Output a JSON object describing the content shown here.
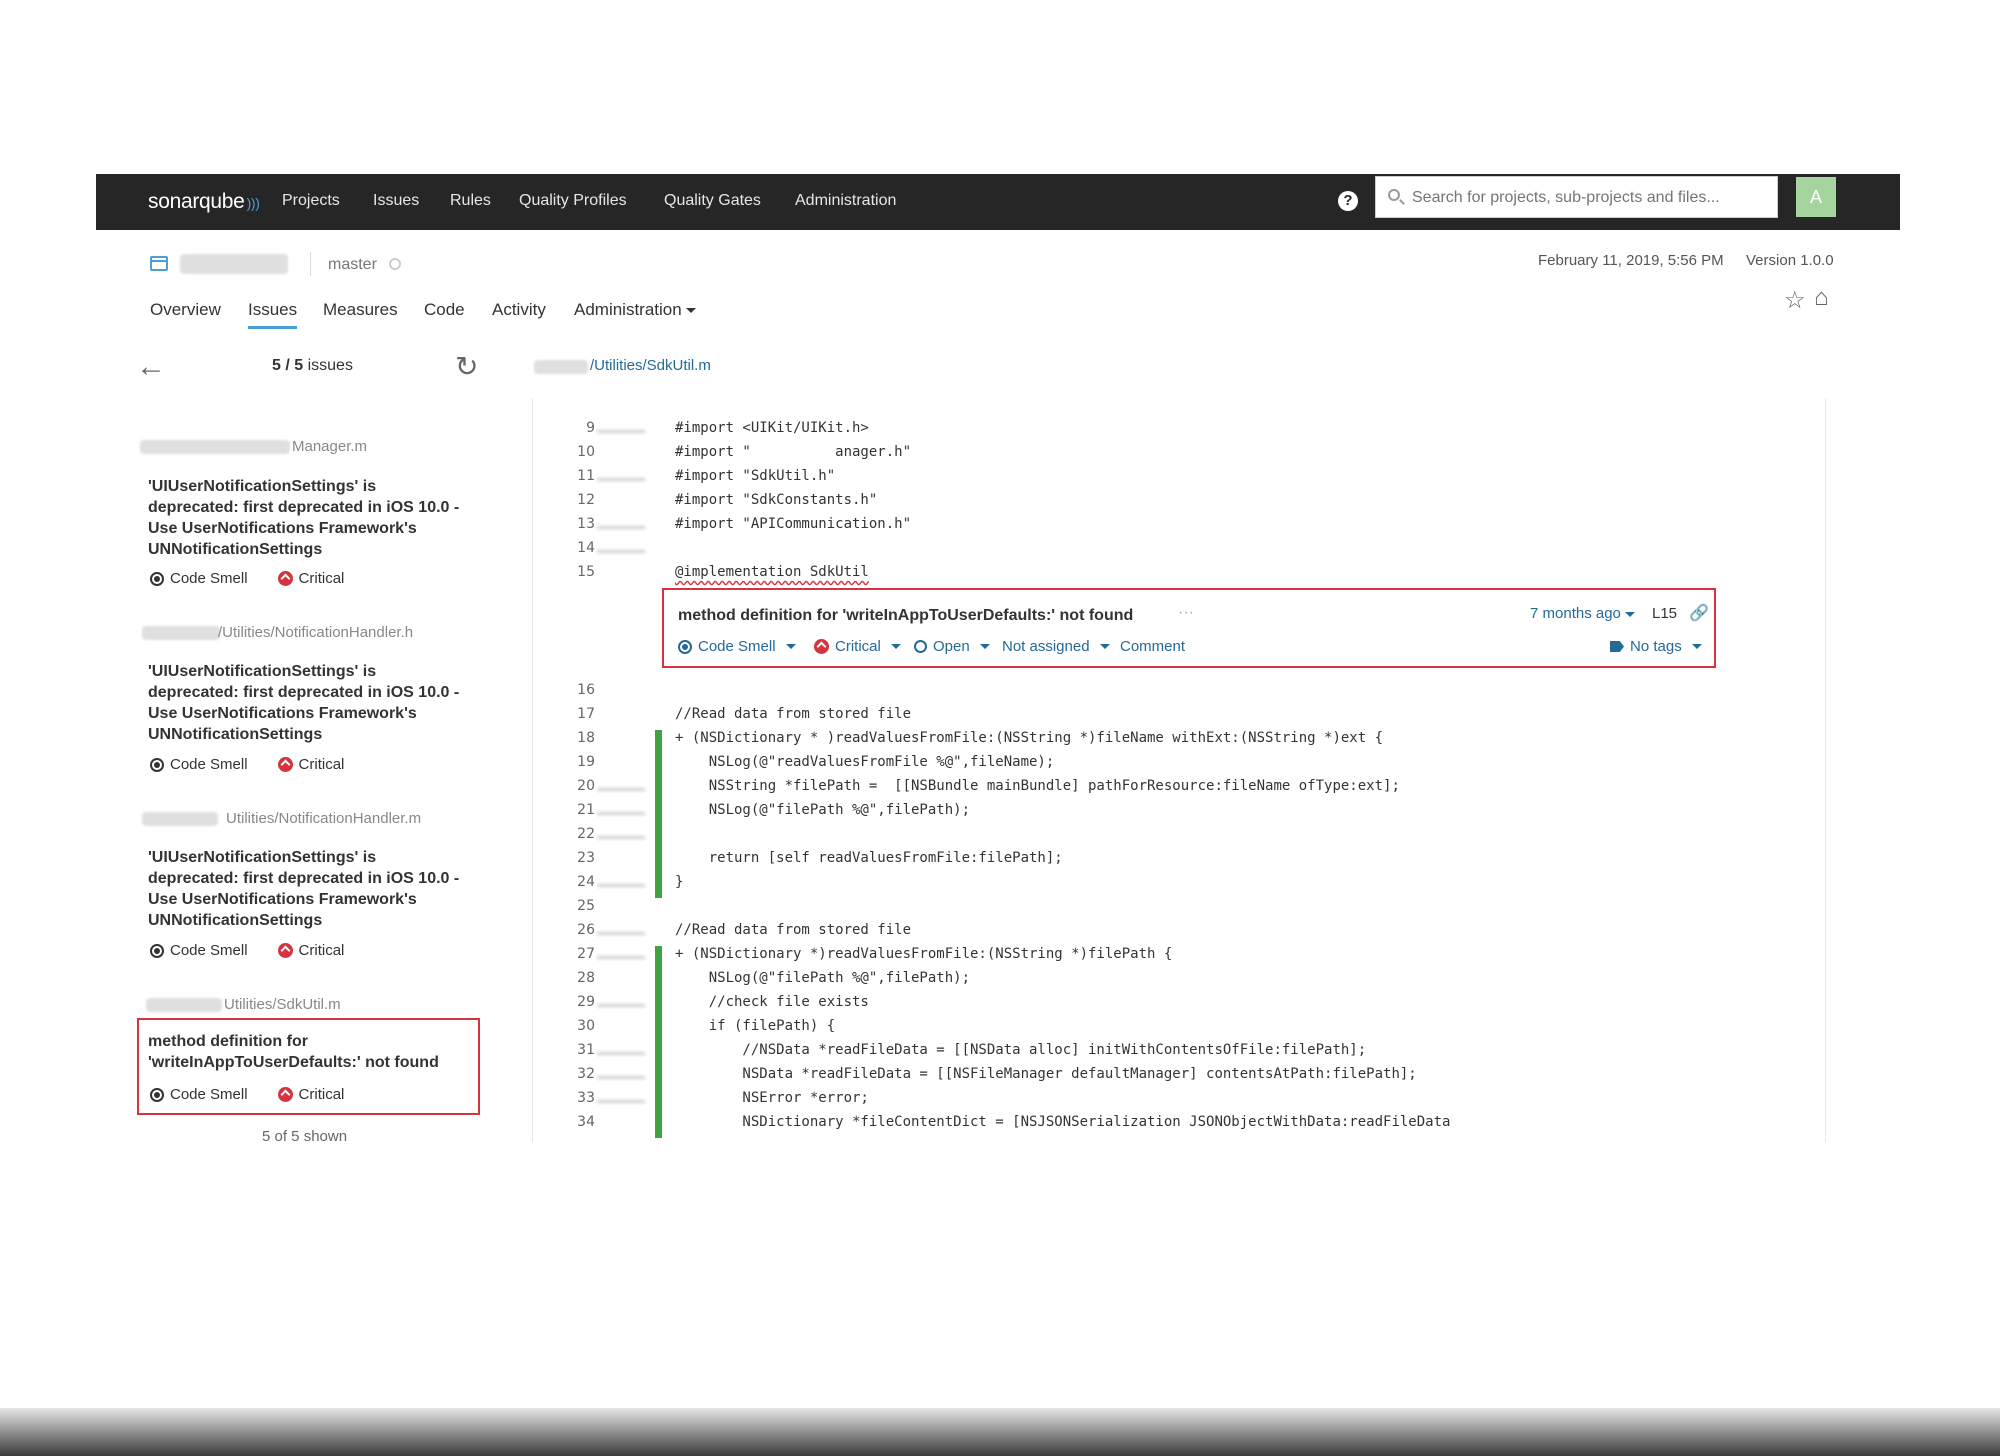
{
  "navbar": {
    "logo": "sonarqube",
    "items": [
      "Projects",
      "Issues",
      "Rules",
      "Quality Profiles",
      "Quality Gates",
      "Administration"
    ],
    "search_placeholder": "Search for projects, sub-projects and files...",
    "avatar": "A"
  },
  "project": {
    "branch": "master",
    "analysis_date": "February 11, 2019, 5:56 PM",
    "version": "Version 1.0.0"
  },
  "tabs": [
    "Overview",
    "Issues",
    "Measures",
    "Code",
    "Activity",
    "Administration"
  ],
  "issues_header": {
    "count_bold": "5 / 5",
    "count_label": "issues",
    "file_path": "/Utilities/SdkUtil.m"
  },
  "issue_list": [
    {
      "file": "Manager.m",
      "message": "'UIUserNotificationSettings' is deprecated: first deprecated in iOS 10.0 - Use UserNotifications Framework's UNNotificationSettings",
      "type": "Code Smell",
      "severity": "Critical"
    },
    {
      "file": "/Utilities/NotificationHandler.h",
      "message": "'UIUserNotificationSettings' is deprecated: first deprecated in iOS 10.0 - Use UserNotifications Framework's UNNotificationSettings",
      "type": "Code Smell",
      "severity": "Critical"
    },
    {
      "file": "Utilities/NotificationHandler.m",
      "message": "'UIUserNotificationSettings' is deprecated: first deprecated in iOS 10.0 - Use UserNotifications Framework's UNNotificationSettings",
      "type": "Code Smell",
      "severity": "Critical"
    },
    {
      "file": "Utilities/SdkUtil.m",
      "message": "method definition for 'writeInAppToUserDefaults:' not found",
      "type": "Code Smell",
      "severity": "Critical"
    }
  ],
  "shown": "5 of 5 shown",
  "issue_box": {
    "message": "method definition for 'writeInAppToUserDefaults:' not found",
    "dots": "···",
    "age": "7 months ago",
    "line": "L15",
    "type": "Code Smell",
    "severity": "Critical",
    "status": "Open",
    "assignee": "Not assigned",
    "comment": "Comment",
    "tags": "No tags"
  },
  "code_before": [
    {
      "n": "9",
      "t": "#import <UIKit/UIKit.h>"
    },
    {
      "n": "10",
      "t": "#import \"          anager.h\""
    },
    {
      "n": "11",
      "t": "#import \"SdkUtil.h\""
    },
    {
      "n": "12",
      "t": "#import \"SdkConstants.h\""
    },
    {
      "n": "13",
      "t": "#import \"APICommunication.h\""
    },
    {
      "n": "14",
      "t": ""
    },
    {
      "n": "15",
      "t": "@implementation SdkUtil"
    }
  ],
  "code_after": [
    {
      "n": "16",
      "t": ""
    },
    {
      "n": "17",
      "t": "//Read data from stored file"
    },
    {
      "n": "18",
      "t": "+ (NSDictionary * )readValuesFromFile:(NSString *)fileName withExt:(NSString *)ext {"
    },
    {
      "n": "19",
      "t": "    NSLog(@\"readValuesFromFile %@\",fileName);"
    },
    {
      "n": "20",
      "t": "    NSString *filePath =  [[NSBundle mainBundle] pathForResource:fileName ofType:ext];"
    },
    {
      "n": "21",
      "t": "    NSLog(@\"filePath %@\",filePath);"
    },
    {
      "n": "22",
      "t": ""
    },
    {
      "n": "23",
      "t": "    return [self readValuesFromFile:filePath];"
    },
    {
      "n": "24",
      "t": "}"
    },
    {
      "n": "25",
      "t": ""
    },
    {
      "n": "26",
      "t": "//Read data from stored file"
    },
    {
      "n": "27",
      "t": "+ (NSDictionary *)readValuesFromFile:(NSString *)filePath {"
    },
    {
      "n": "28",
      "t": "    NSLog(@\"filePath %@\",filePath);"
    },
    {
      "n": "29",
      "t": "    //check file exists"
    },
    {
      "n": "30",
      "t": "    if (filePath) {"
    },
    {
      "n": "31",
      "t": "        //NSData *readFileData = [[NSData alloc] initWithContentsOfFile:filePath];"
    },
    {
      "n": "32",
      "t": "        NSData *readFileData = [[NSFileManager defaultManager] contentsAtPath:filePath];"
    },
    {
      "n": "33",
      "t": "        NSError *error;"
    },
    {
      "n": "34",
      "t": "        NSDictionary *fileContentDict = [NSJSONSerialization JSONObjectWithData:readFileData"
    }
  ]
}
